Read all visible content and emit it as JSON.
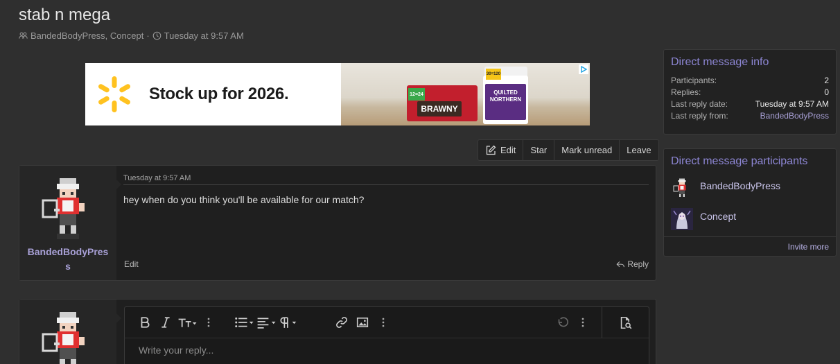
{
  "thread": {
    "title": "stab n mega",
    "participants_line": "BandedBodyPress, Concept",
    "separator": "·",
    "date": "Tuesday at 9:57 AM"
  },
  "ad": {
    "headline": "Stock up for 2026.",
    "brand_color": "#ffc220",
    "product1_badge": "12=24",
    "product1_label": "BRAWNY",
    "product2_badge": "30=120",
    "product2_label": "QUILTED NORTHERN"
  },
  "actions": {
    "edit": "Edit",
    "star": "Star",
    "mark_unread": "Mark unread",
    "leave": "Leave"
  },
  "message": {
    "author": "BandedBodyPress",
    "date": "Tuesday at 9:57 AM",
    "text": "hey when do you think you'll be available for our match?",
    "edit_label": "Edit",
    "reply_label": "Reply"
  },
  "reply_editor": {
    "placeholder": "Write your reply..."
  },
  "sidebar": {
    "info": {
      "title": "Direct message info",
      "rows": [
        {
          "label": "Participants:",
          "value": "2"
        },
        {
          "label": "Replies:",
          "value": "0"
        },
        {
          "label": "Last reply date:",
          "value": "Tuesday at 9:57 AM"
        },
        {
          "label": "Last reply from:",
          "value": "BandedBodyPress"
        }
      ]
    },
    "participants": {
      "title": "Direct message participants",
      "items": [
        {
          "name": "BandedBodyPress"
        },
        {
          "name": "Concept"
        }
      ],
      "invite_label": "Invite more"
    }
  },
  "colors": {
    "background": "#2f2f2f",
    "accent": "#8d86d4",
    "username": "#a8a0d6"
  }
}
